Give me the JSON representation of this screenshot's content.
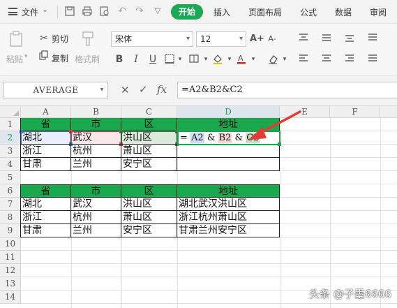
{
  "menubar": {
    "file_label": "文件",
    "tabs": [
      "开始",
      "插入",
      "页面布局",
      "公式",
      "数据",
      "审阅"
    ],
    "active_tab": "开始"
  },
  "ribbon": {
    "paste_label": "粘贴",
    "cut_label": "剪切",
    "copy_label": "复制",
    "format_painter_label": "格式刷",
    "font_name": "宋体",
    "font_size": "12",
    "bold": "B",
    "italic": "I",
    "underline": "U",
    "grow_font": "A+",
    "shrink_font": "A-"
  },
  "formula_bar": {
    "name_box": "AVERAGE",
    "cancel_symbol": "✕",
    "accept_symbol": "✓",
    "fx_symbol": "fx",
    "formula": "=A2&B2&C2"
  },
  "grid": {
    "columns": [
      "A",
      "B",
      "C",
      "D",
      "E",
      "F"
    ],
    "rows": [
      "1",
      "2",
      "3",
      "4",
      "5",
      "6",
      "7",
      "8",
      "9",
      "10",
      "11",
      "12",
      "13",
      "14"
    ],
    "table1": {
      "headers": [
        "省",
        "市",
        "区",
        "地址"
      ],
      "rows": [
        [
          "湖北",
          "武汉",
          "洪山区",
          ""
        ],
        [
          "浙江",
          "杭州",
          "萧山区",
          ""
        ],
        [
          "甘肃",
          "兰州",
          "安宁区",
          ""
        ]
      ]
    },
    "table2": {
      "headers": [
        "省",
        "市",
        "区",
        "地址"
      ],
      "rows": [
        [
          "湖北",
          "武汉",
          "洪山区",
          "湖北武汉洪山区"
        ],
        [
          "浙江",
          "杭州",
          "萧山区",
          "浙江杭州萧山区"
        ],
        [
          "甘肃",
          "兰州",
          "安宁区",
          "甘肃兰州安宁区"
        ]
      ]
    },
    "edit_cell": {
      "eq": "=",
      "ref_a": "A2",
      "amp1": "&",
      "ref_b": "B2",
      "amp2": "&",
      "ref_c": "C2"
    }
  },
  "colors": {
    "accent": "#1aa84f",
    "ref_a": "#3e73d6",
    "ref_b": "#d2454d",
    "ref_c": "#3b8a3b",
    "arrow": "#e53935"
  },
  "watermark": "头条 @子墨6666"
}
